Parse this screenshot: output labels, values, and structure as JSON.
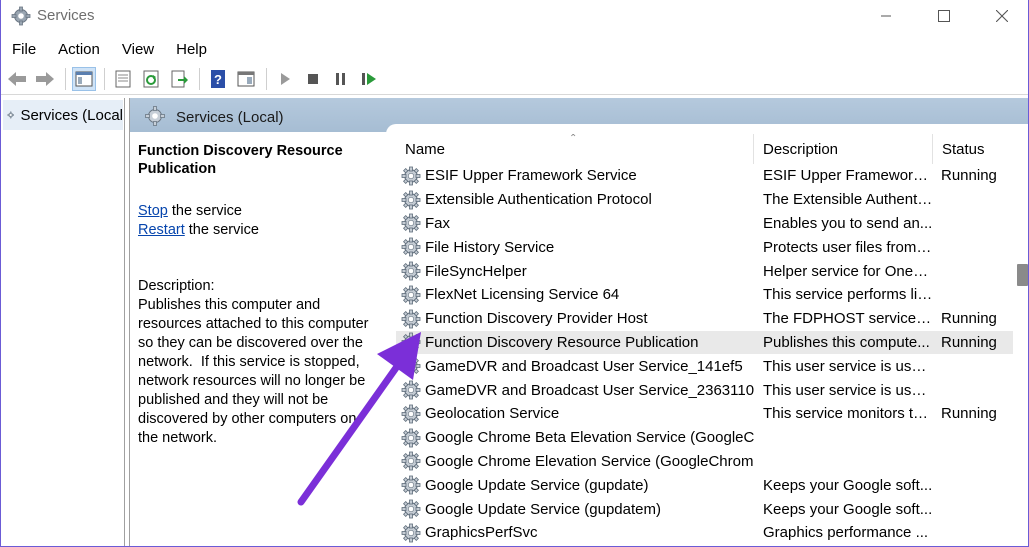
{
  "window": {
    "title": "Services",
    "controls": {
      "minimize": "minimize-icon",
      "maximize": "maximize-icon",
      "close": "close-icon"
    }
  },
  "menu": [
    "File",
    "Action",
    "View",
    "Help"
  ],
  "toolbar": {
    "buttons": [
      "back-icon",
      "forward-icon",
      "show-hide-console-tree-icon",
      "properties-icon",
      "refresh-icon",
      "export-list-icon",
      "help-icon",
      "console-tree-icon",
      "start-service-icon",
      "stop-service-icon",
      "pause-service-icon",
      "resume-service-icon"
    ]
  },
  "tree": {
    "node_label": "Services (Local"
  },
  "pane": {
    "header_title": "Services (Local)"
  },
  "description_panel": {
    "service_title": "Function Discovery Resource Publication",
    "stop_link": "Stop",
    "stop_suffix": " the service",
    "restart_link": "Restart",
    "restart_suffix": " the service",
    "label": "Description:",
    "text": "Publishes this computer and resources attached to this computer so they can be discovered over the network.  If this service is stopped, network resources will no longer be published and they will not be discovered by other computers on the network."
  },
  "list": {
    "columns": {
      "name": "Name",
      "description": "Description",
      "status": "Status"
    },
    "selected_index": 7,
    "rows": [
      {
        "name": "ESIF Upper Framework Service",
        "description": "ESIF Upper Framework ...",
        "status": "Running"
      },
      {
        "name": "Extensible Authentication Protocol",
        "description": "The Extensible Authenti...",
        "status": ""
      },
      {
        "name": "Fax",
        "description": "Enables you to send an...",
        "status": ""
      },
      {
        "name": "File History Service",
        "description": "Protects user files from ...",
        "status": ""
      },
      {
        "name": "FileSyncHelper",
        "description": "Helper service for OneD...",
        "status": ""
      },
      {
        "name": "FlexNet Licensing Service 64",
        "description": "This service performs lic...",
        "status": ""
      },
      {
        "name": "Function Discovery Provider Host",
        "description": "The FDPHOST service h...",
        "status": "Running"
      },
      {
        "name": "Function Discovery Resource Publication",
        "description": "Publishes this compute...",
        "status": "Running"
      },
      {
        "name": "GameDVR and Broadcast User Service_141ef5",
        "description": "This user service is used...",
        "status": ""
      },
      {
        "name": "GameDVR and Broadcast User Service_2363110",
        "description": "This user service is used...",
        "status": ""
      },
      {
        "name": "Geolocation Service",
        "description": "This service monitors th...",
        "status": "Running"
      },
      {
        "name": "Google Chrome Beta Elevation Service (GoogleC...",
        "description": "",
        "status": ""
      },
      {
        "name": "Google Chrome Elevation Service (GoogleChrom...",
        "description": "",
        "status": ""
      },
      {
        "name": "Google Update Service (gupdate)",
        "description": "Keeps your Google soft...",
        "status": ""
      },
      {
        "name": "Google Update Service (gupdatem)",
        "description": "Keeps your Google soft...",
        "status": ""
      },
      {
        "name": "GraphicsPerfSvc",
        "description": "Graphics performance ...",
        "status": ""
      }
    ]
  },
  "colors": {
    "annotation_arrow": "#7b2fd8",
    "header_band": "#aec3d8",
    "selection": "#e9e9e9",
    "link": "#0645ad"
  }
}
